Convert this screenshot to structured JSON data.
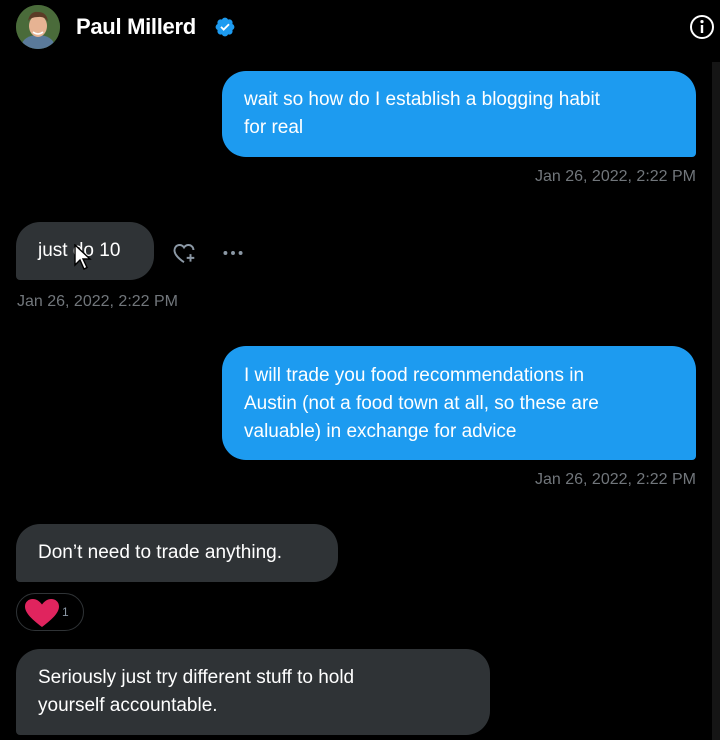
{
  "header": {
    "name": "Paul Millerd",
    "verified_icon": "verified-badge-icon",
    "info_icon": "info-icon"
  },
  "messages": [
    {
      "direction": "outgoing",
      "text": "wait so how do I establish a blogging habit\nfor real",
      "timestamp": "Jan 26, 2022, 2:22 PM"
    },
    {
      "direction": "incoming",
      "text": "just do 10",
      "timestamp": "Jan 26, 2022, 2:22 PM"
    },
    {
      "direction": "outgoing",
      "text": "I will trade you food recommendations in\nAustin (not a food town at all, so these are\nvaluable) in exchange for advice",
      "timestamp": "Jan 26, 2022, 2:22 PM"
    },
    {
      "direction": "incoming",
      "text": "Don’t need to trade anything.",
      "reaction": {
        "icon": "heart-icon",
        "count": "1"
      }
    },
    {
      "direction": "incoming",
      "text": "Seriously just try different stuff to hold\nyourself accountable."
    }
  ],
  "colors": {
    "background": "#000000",
    "outgoing_bubble": "#1d9bf0",
    "incoming_bubble": "#2f3336",
    "timestamp": "#71767b",
    "verified": "#1d9bf0",
    "heart": "#f91880"
  }
}
